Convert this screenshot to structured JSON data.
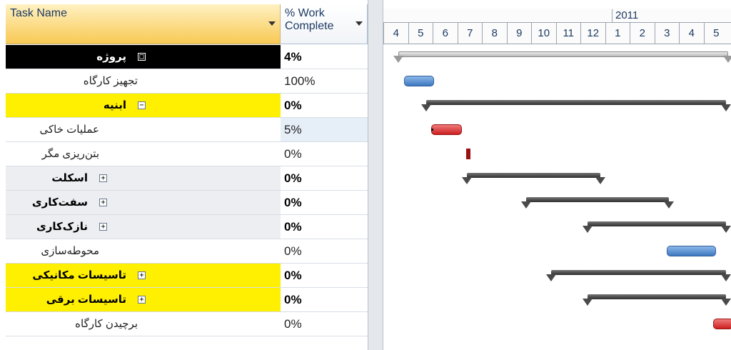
{
  "columns": {
    "task_name": "Task Name",
    "work_complete": "% Work\nComplete"
  },
  "timeline": {
    "year": "2011",
    "months": [
      "4",
      "5",
      "6",
      "7",
      "8",
      "9",
      "10",
      "11",
      "12",
      "1",
      "2",
      "3",
      "4",
      "5"
    ]
  },
  "rows": [
    {
      "name": "پروژه",
      "work": "4%",
      "level": 0,
      "summary": true,
      "style": "black",
      "toggle": "□"
    },
    {
      "name": "تجهیز کارگاه",
      "work": "100%",
      "level": 1,
      "summary": false,
      "style": "",
      "toggle": ""
    },
    {
      "name": "ابنیه",
      "work": "0%",
      "level": 1,
      "summary": true,
      "style": "yellow",
      "toggle": "−"
    },
    {
      "name": "عملیات خاکی",
      "work": "5%",
      "level": 2,
      "summary": false,
      "style": "",
      "toggle": ""
    },
    {
      "name": "بتن‌ریزی مگر",
      "work": "0%",
      "level": 2,
      "summary": false,
      "style": "",
      "toggle": ""
    },
    {
      "name": "اسکلت",
      "work": "0%",
      "level": 2,
      "summary": true,
      "style": "gray",
      "toggle": "+"
    },
    {
      "name": "سفت‌کاری",
      "work": "0%",
      "level": 2,
      "summary": true,
      "style": "gray",
      "toggle": "+"
    },
    {
      "name": "نازک‌کاری",
      "work": "0%",
      "level": 2,
      "summary": true,
      "style": "gray",
      "toggle": "+"
    },
    {
      "name": "محوطه‌سازی",
      "work": "0%",
      "level": 2,
      "summary": false,
      "style": "",
      "toggle": ""
    },
    {
      "name": "تاسیسات مکانیکی",
      "work": "0%",
      "level": 1,
      "summary": true,
      "style": "yellow",
      "toggle": "+"
    },
    {
      "name": "تاسیسات برقی",
      "work": "0%",
      "level": 1,
      "summary": true,
      "style": "yellow",
      "toggle": "+"
    },
    {
      "name": "برچیدن کارگاه",
      "work": "0%",
      "level": 1,
      "summary": false,
      "style": "",
      "toggle": ""
    }
  ],
  "gantt": [
    {
      "type": "project",
      "start": 1.6,
      "end": 15.0
    },
    {
      "type": "task",
      "color": "blue",
      "start": 1.85,
      "end": 3.05
    },
    {
      "type": "summary",
      "start": 2.75,
      "end": 14.9
    },
    {
      "type": "task",
      "color": "red",
      "start": 2.95,
      "end": 4.2,
      "progress": 0.05
    },
    {
      "type": "task",
      "color": "darkred",
      "start": 4.35,
      "end": 4.55
    },
    {
      "type": "summary",
      "start": 4.4,
      "end": 9.8
    },
    {
      "type": "summary",
      "start": 6.8,
      "end": 12.6
    },
    {
      "type": "summary",
      "start": 9.3,
      "end": 14.9
    },
    {
      "type": "task",
      "color": "blue",
      "start": 12.5,
      "end": 14.5
    },
    {
      "type": "summary",
      "start": 7.8,
      "end": 14.9
    },
    {
      "type": "summary",
      "start": 9.3,
      "end": 14.9
    },
    {
      "type": "task",
      "color": "red",
      "start": 14.4,
      "end": 15.2
    }
  ],
  "colors": {
    "summary_yellow": "#ffef00",
    "project_black": "#000000",
    "task_blue": "#3e78bf",
    "task_red": "#cc1f1f"
  }
}
